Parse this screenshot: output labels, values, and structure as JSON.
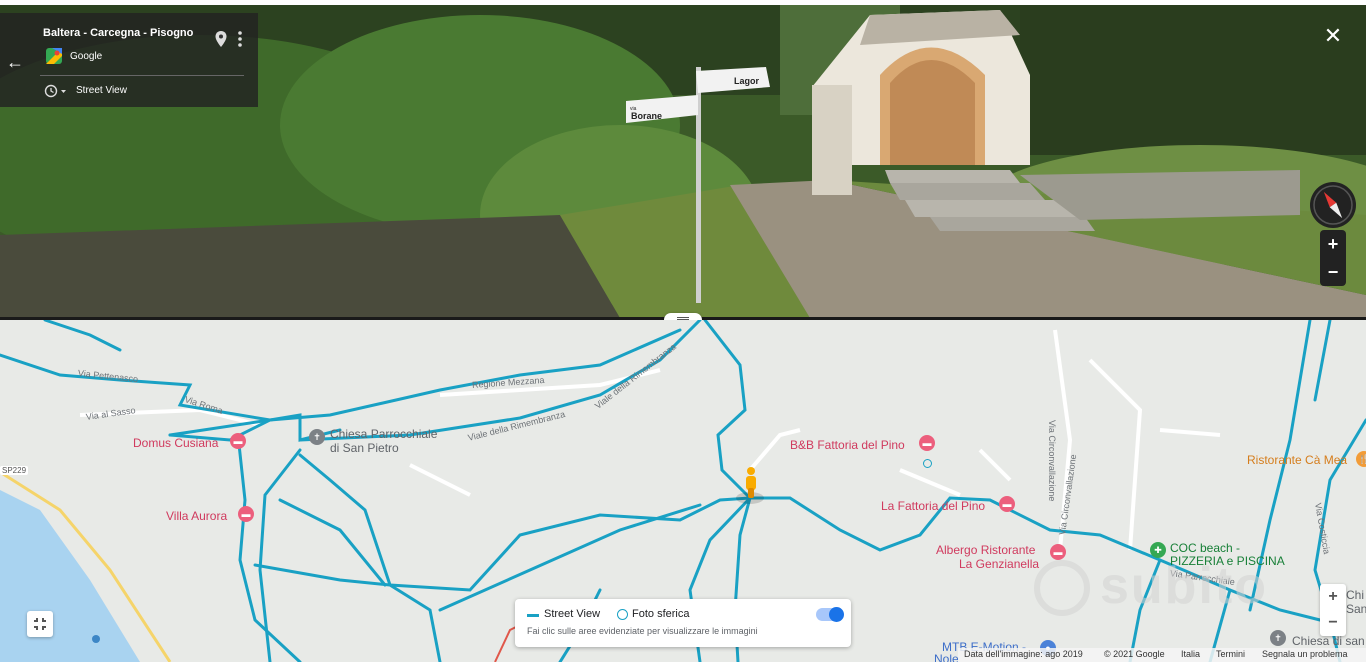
{
  "street_view": {
    "location_title": "Baltera - Carcegna - Pisogno",
    "provider": "Google",
    "mode_label": "Street View",
    "sign_left": "Borane",
    "sign_left_small": "via",
    "sign_right": "Lagor"
  },
  "map": {
    "places": [
      {
        "label": "Domus Cusiana",
        "kind": "hotel"
      },
      {
        "label": "Villa Aurora",
        "kind": "hotel"
      },
      {
        "label": "Chiesa Parrocchiale",
        "kind": "church"
      },
      {
        "label": "di San Pietro",
        "kind": "church"
      },
      {
        "label": "B&B Fattoria del Pino",
        "kind": "hotel"
      },
      {
        "label": "La Fattoria del Pino",
        "kind": "hotel"
      },
      {
        "label": "Albergo Ristorante",
        "kind": "hotel"
      },
      {
        "label": "La Genzianella",
        "kind": "hotel"
      },
      {
        "label": "COC beach -",
        "kind": "leisure"
      },
      {
        "label": "PIZZERIA e PISCINA",
        "kind": "leisure"
      },
      {
        "label": "Ristorante Cà Mea",
        "kind": "restaurant"
      },
      {
        "label": "MTB E-Motion -",
        "kind": "shop"
      },
      {
        "label": "Nole",
        "kind": "shop"
      },
      {
        "label": "Chiesa di san",
        "kind": "church"
      },
      {
        "label": "Chi",
        "kind": "church"
      },
      {
        "label": "San",
        "kind": "church"
      }
    ],
    "roads": {
      "via_pettenasco": "Via Pettenasco",
      "via_roma": "Via Roma",
      "via_al_sasso": "Via al Sasso",
      "regione_mezzana": "Regione Mezzana",
      "viale_rimembranza_1": "Viale della Rimembranza",
      "viale_rimembranza_2": "Viale della Rimembranza",
      "via_circonvallazione_1": "Via Circonvallazione",
      "via_circonvallazione_2": "Via Circonvallazione",
      "via_parrocchiale": "Via Parrocchiale",
      "via_costiccia": "Via Costiccia",
      "sp229": "SP229"
    },
    "legend": {
      "street_view": "Street View",
      "photo_sphere": "Foto sferica",
      "hint": "Fai clic sulle aree evidenziate per visualizzare le immagini",
      "toggle_on": true
    },
    "footer": {
      "image_date": "Data dell'immagine: ago 2019",
      "copyright": "© 2021 Google",
      "country": "Italia",
      "terms": "Termini",
      "report": "Segnala un problema"
    },
    "watermark": "subito"
  },
  "controls": {
    "zoom_in": "+",
    "zoom_out": "−",
    "close": "✕",
    "back": "←"
  },
  "colors": {
    "road_blue": "#19a1c4",
    "poi_red": "#d03a5e",
    "poi_green": "#188038",
    "poi_orange": "#d57d1c",
    "toggle_blue": "#1a73e8",
    "map_bg": "#e8eae7"
  }
}
